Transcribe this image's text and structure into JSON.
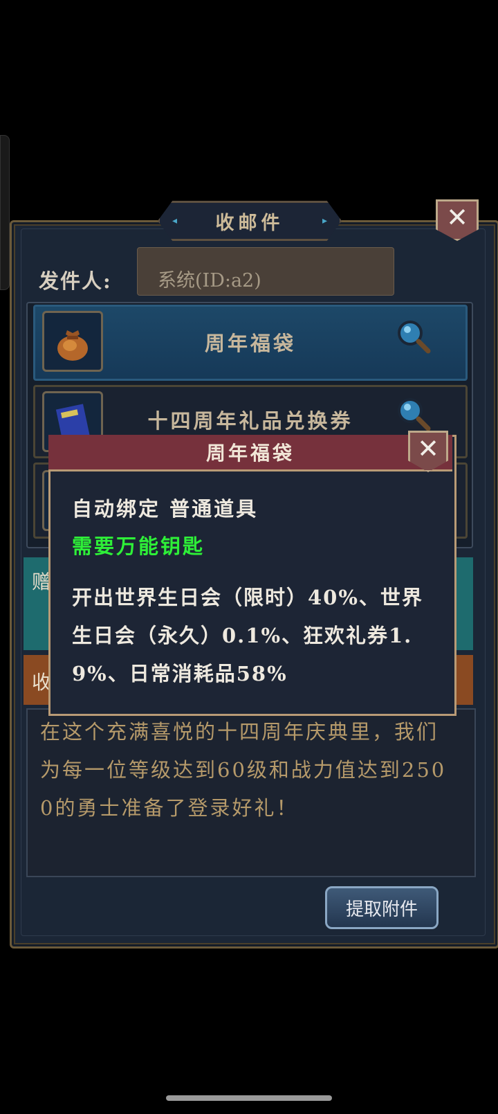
{
  "window": {
    "title": "收邮件",
    "close_icon": "close-icon"
  },
  "sender": {
    "label": "发件人:",
    "value": "系统(ID:a2)"
  },
  "items": [
    {
      "name": "周年福袋",
      "icon": "lucky-bag-icon",
      "selected": true
    },
    {
      "name": "十四周年礼品兑换券",
      "icon": "book-icon",
      "selected": false
    },
    {
      "name": "",
      "icon": "item-icon",
      "selected": false
    }
  ],
  "tabs": {
    "teal_glyph": "赠",
    "brown_glyph": "收"
  },
  "message": {
    "body": "在这个充满喜悦的十四周年庆典里，我们为每一位等级达到60级和战力值达到2500的勇士准备了登录好礼！"
  },
  "actions": {
    "extract_label": "提取附件"
  },
  "tooltip": {
    "title": "周年福袋",
    "line1": "自动绑定  普通道具",
    "line2": "需要万能钥匙",
    "description": "开出世界生日会（限时）40%、世界生日会（永久）0.1%、狂欢礼券1.9%、日常消耗品58%"
  },
  "colors": {
    "panel_bg": "#1b2636",
    "selected_row": "#1d4868",
    "tooltip_header": "#76313c",
    "tooltip_green": "#2ef038",
    "body_text": "#b69a6a"
  }
}
